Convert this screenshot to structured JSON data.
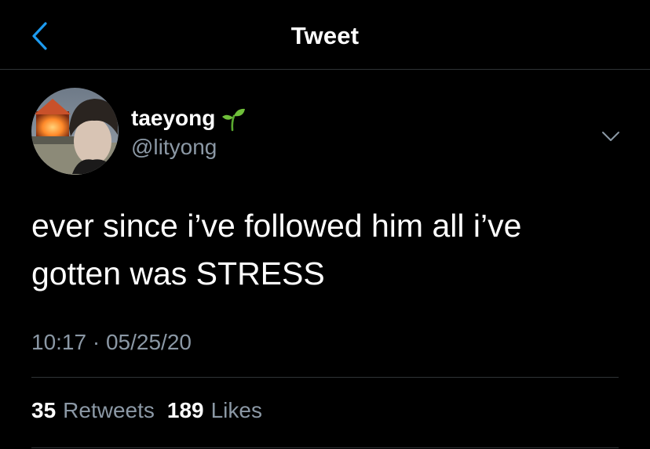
{
  "colors": {
    "background": "#000000",
    "accent": "#1d9bf0",
    "secondary_text": "#8b98a5",
    "divider": "#2f3336",
    "sprout": "#6fbf3a"
  },
  "header": {
    "back_icon": "chevron-left-icon",
    "title": "Tweet"
  },
  "author": {
    "display_name": "taeyong",
    "emoji_icon": "seedling-icon",
    "handle": "@lityong",
    "menu_icon": "chevron-down-icon"
  },
  "tweet": {
    "text": "ever since i’ve followed him all i’ve\ngotten was STRESS",
    "time": "10:17",
    "separator": "·",
    "date": "05/25/20"
  },
  "stats": {
    "retweets_count": "35",
    "retweets_label": "Retweets",
    "likes_count": "189",
    "likes_label": "Likes"
  }
}
